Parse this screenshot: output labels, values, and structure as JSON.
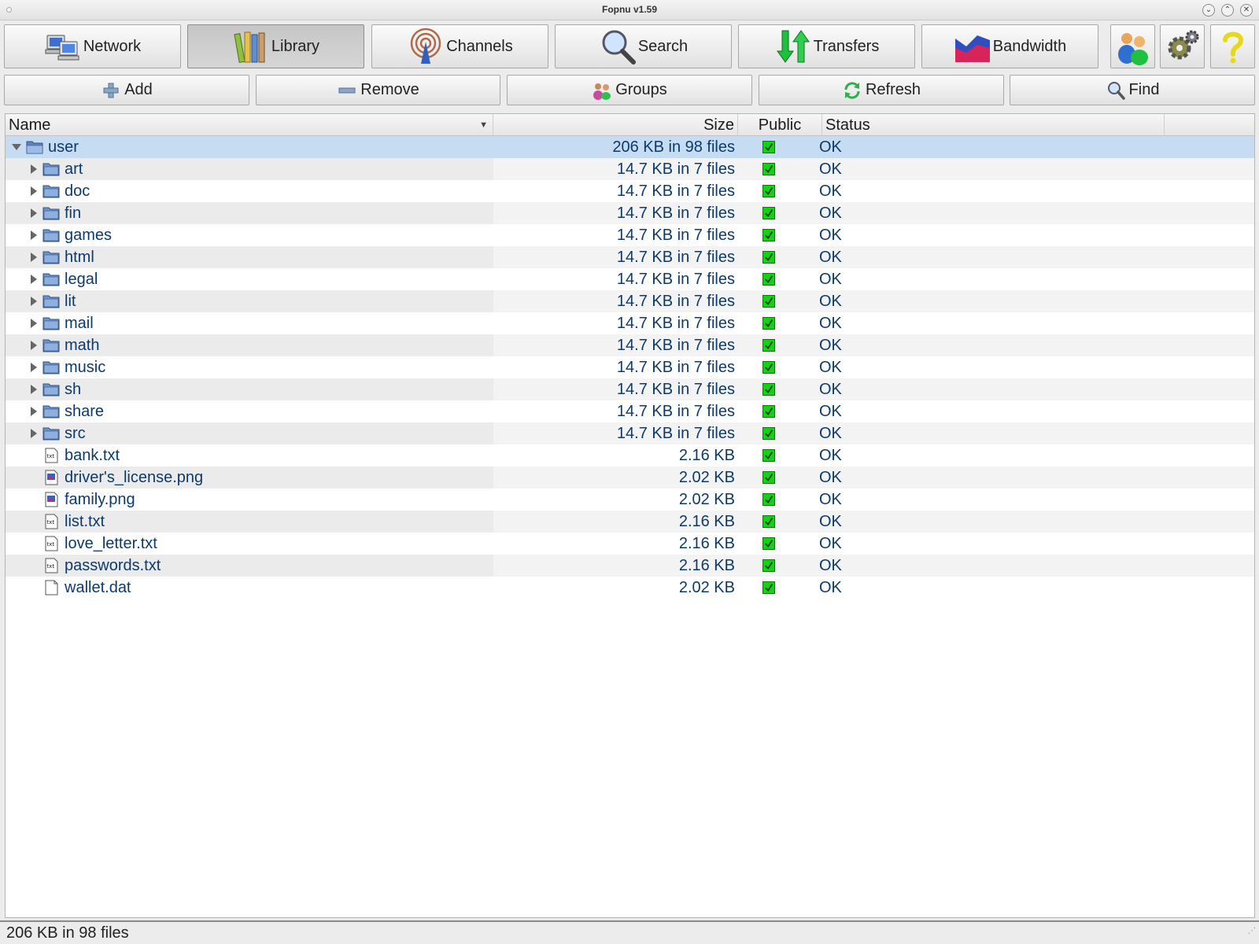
{
  "window": {
    "title": "Fopnu v1.59",
    "minimize_glyph": "⌄",
    "maximize_glyph": "⌃",
    "close_glyph": "✕"
  },
  "main_toolbar": {
    "network": "Network",
    "library": "Library",
    "channels": "Channels",
    "search": "Search",
    "transfers": "Transfers",
    "bandwidth": "Bandwidth",
    "active_tab": "Library"
  },
  "action_toolbar": {
    "add": "Add",
    "remove": "Remove",
    "groups": "Groups",
    "refresh": "Refresh",
    "find": "Find"
  },
  "table": {
    "columns": {
      "name": "Name",
      "size": "Size",
      "public": "Public",
      "status": "Status",
      "sort_glyph": "▼"
    },
    "rows": [
      {
        "name": "user",
        "size": "206 KB in 98 files",
        "status": "OK",
        "public": true,
        "type": "folder-open",
        "level": 0,
        "selected": true
      },
      {
        "name": "art",
        "size": "14.7 KB in 7 files",
        "status": "OK",
        "public": true,
        "type": "folder",
        "level": 1
      },
      {
        "name": "doc",
        "size": "14.7 KB in 7 files",
        "status": "OK",
        "public": true,
        "type": "folder",
        "level": 1
      },
      {
        "name": "fin",
        "size": "14.7 KB in 7 files",
        "status": "OK",
        "public": true,
        "type": "folder",
        "level": 1
      },
      {
        "name": "games",
        "size": "14.7 KB in 7 files",
        "status": "OK",
        "public": true,
        "type": "folder",
        "level": 1
      },
      {
        "name": "html",
        "size": "14.7 KB in 7 files",
        "status": "OK",
        "public": true,
        "type": "folder",
        "level": 1
      },
      {
        "name": "legal",
        "size": "14.7 KB in 7 files",
        "status": "OK",
        "public": true,
        "type": "folder",
        "level": 1
      },
      {
        "name": "lit",
        "size": "14.7 KB in 7 files",
        "status": "OK",
        "public": true,
        "type": "folder",
        "level": 1
      },
      {
        "name": "mail",
        "size": "14.7 KB in 7 files",
        "status": "OK",
        "public": true,
        "type": "folder",
        "level": 1
      },
      {
        "name": "math",
        "size": "14.7 KB in 7 files",
        "status": "OK",
        "public": true,
        "type": "folder",
        "level": 1
      },
      {
        "name": "music",
        "size": "14.7 KB in 7 files",
        "status": "OK",
        "public": true,
        "type": "folder",
        "level": 1
      },
      {
        "name": "sh",
        "size": "14.7 KB in 7 files",
        "status": "OK",
        "public": true,
        "type": "folder",
        "level": 1
      },
      {
        "name": "share",
        "size": "14.7 KB in 7 files",
        "status": "OK",
        "public": true,
        "type": "folder",
        "level": 1
      },
      {
        "name": "src",
        "size": "14.7 KB in 7 files",
        "status": "OK",
        "public": true,
        "type": "folder",
        "level": 1
      },
      {
        "name": "bank.txt",
        "size": "2.16 KB",
        "status": "OK",
        "public": true,
        "type": "text-file",
        "level": 1
      },
      {
        "name": "driver's_license.png",
        "size": "2.02 KB",
        "status": "OK",
        "public": true,
        "type": "image-file",
        "level": 1
      },
      {
        "name": "family.png",
        "size": "2.02 KB",
        "status": "OK",
        "public": true,
        "type": "image-file",
        "level": 1
      },
      {
        "name": "list.txt",
        "size": "2.16 KB",
        "status": "OK",
        "public": true,
        "type": "text-file",
        "level": 1
      },
      {
        "name": "love_letter.txt",
        "size": "2.16 KB",
        "status": "OK",
        "public": true,
        "type": "text-file",
        "level": 1
      },
      {
        "name": "passwords.txt",
        "size": "2.16 KB",
        "status": "OK",
        "public": true,
        "type": "text-file",
        "level": 1
      },
      {
        "name": "wallet.dat",
        "size": "2.02 KB",
        "status": "OK",
        "public": true,
        "type": "generic-file",
        "level": 1
      }
    ]
  },
  "statusbar": {
    "text": "206 KB in 98 files"
  },
  "colors": {
    "selected_row": "#c6dcf3",
    "text": "#0d3a6a",
    "check": "#12d212"
  }
}
